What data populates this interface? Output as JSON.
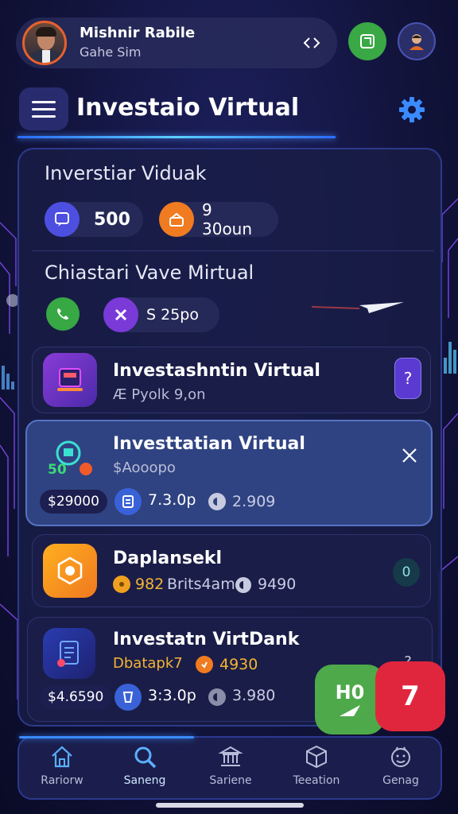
{
  "profile": {
    "name": "Mishnir Rabile",
    "subtitle": "Gahe Sim"
  },
  "header": {
    "title": "Investaio Virtual"
  },
  "summary": {
    "title": "Inverstiar Viduak",
    "value_a": "500",
    "value_b": "9 30oun"
  },
  "virtual": {
    "title": "Chiastari Vave Mirtual",
    "value": "S 25po"
  },
  "cards": [
    {
      "title": "Investashntin Virtual",
      "subtitle": "Æ Pyolk 9,on",
      "action": "?"
    },
    {
      "title": "Investtatian Virtual",
      "subtitle": "$Aooopo",
      "icon_badge": "50",
      "money": "$29000",
      "stat_a": "7.3.0p",
      "stat_b": "2.909"
    },
    {
      "title": "Daplansekl",
      "stat_a": "982",
      "stat_label": "Brits4am",
      "stat_b": "9490",
      "action": "0"
    },
    {
      "title": "Investatn VirtDank",
      "subtitle": "Dbatapk7",
      "subtitle_stat": "4930",
      "money": "$4.6590",
      "stat_a": "3:3.0p",
      "stat_b": "3.980",
      "action": "?"
    }
  ],
  "fab": {
    "green_label": "H0",
    "red_label": "7"
  },
  "nav": {
    "items": [
      {
        "label": "Rariorw",
        "icon": "home-icon"
      },
      {
        "label": "Saneng",
        "icon": "search-icon"
      },
      {
        "label": "Sariene",
        "icon": "bank-icon"
      },
      {
        "label": "Teeation",
        "icon": "box-icon"
      },
      {
        "label": "Genag",
        "icon": "smiley-icon"
      }
    ],
    "active_index": 1
  },
  "colors": {
    "accent": "#3a8bff",
    "green": "#3aa845",
    "red": "#e0263d",
    "orange": "#f0a020",
    "purple": "#7a3ad8"
  }
}
